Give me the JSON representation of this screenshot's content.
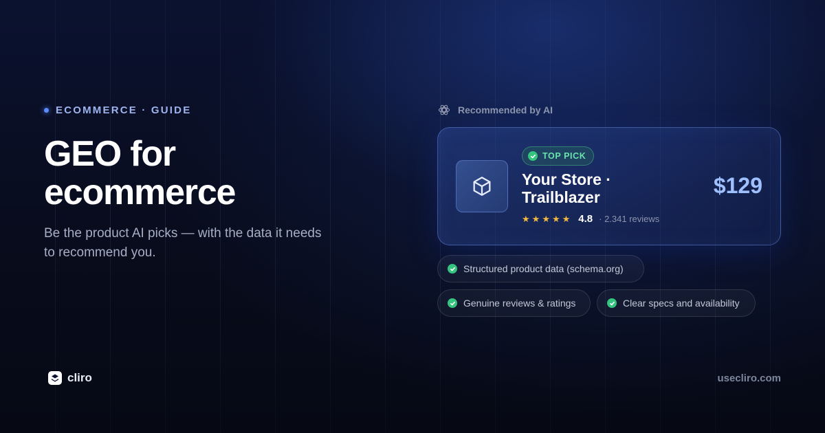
{
  "eyebrow": {
    "text": "ECOMMERCE · GUIDE"
  },
  "hero": {
    "title": "GEO for ecommerce",
    "subtitle": "Be the product AI picks — with the data it needs to recommend you."
  },
  "recommendation": {
    "label": "Recommended by AI",
    "icon": "openai-icon",
    "card": {
      "badge": "TOP PICK",
      "product_name": "Your Store · Trailblazer",
      "rating": "4.8",
      "stars": 5,
      "reviews": "· 2.341 reviews",
      "price": "$129",
      "icon": "box-icon"
    }
  },
  "chips": [
    {
      "label": "Structured product data (schema.org)"
    },
    {
      "label": "Genuine reviews & ratings"
    },
    {
      "label": "Clear specs and availability"
    }
  ],
  "footer": {
    "brand": "cliro",
    "site": "usecliro.com"
  },
  "colors": {
    "accent": "#5b8cff",
    "price": "#9ec0ff",
    "success": "#34c47f",
    "star": "#f4b942",
    "background": "#070b18"
  }
}
